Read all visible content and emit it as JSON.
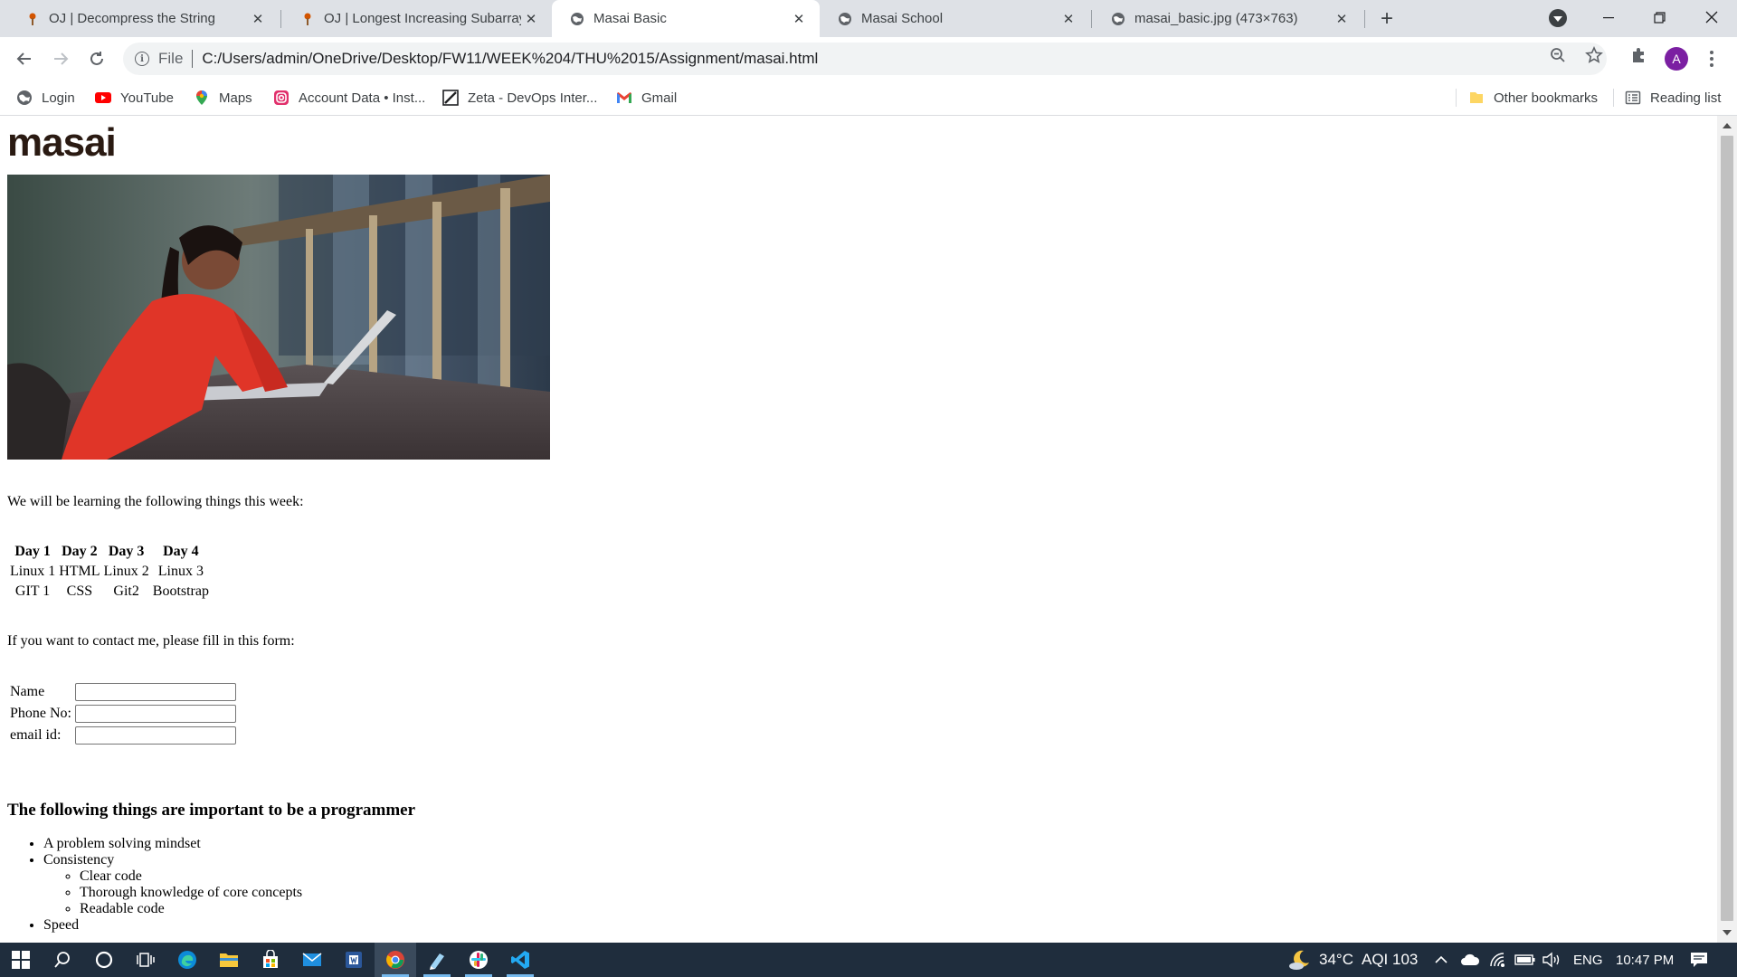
{
  "browser": {
    "tabs": [
      {
        "title": "OJ | Decompress the String",
        "favicon": "pin-favicon",
        "active": false
      },
      {
        "title": "OJ | Longest Increasing Subarray",
        "favicon": "pin-favicon",
        "active": false
      },
      {
        "title": "Masai Basic",
        "favicon": "globe-favicon",
        "active": true
      },
      {
        "title": "Masai School",
        "favicon": "globe-favicon",
        "active": false
      },
      {
        "title": "masai_basic.jpg (473×763)",
        "favicon": "globe-favicon",
        "active": false
      }
    ],
    "address": {
      "scheme_label": "File",
      "url": "C:/Users/admin/OneDrive/Desktop/FW11/WEEK%204/THU%2015/Assignment/masai.html"
    },
    "profile_initial": "A",
    "bookmarks": [
      {
        "label": "Login",
        "icon": "globe-icon"
      },
      {
        "label": "YouTube",
        "icon": "youtube-icon"
      },
      {
        "label": "Maps",
        "icon": "maps-pin-icon"
      },
      {
        "label": "Account Data • Inst...",
        "icon": "instagram-icon"
      },
      {
        "label": "Zeta - DevOps Inter...",
        "icon": "zeta-icon"
      },
      {
        "label": "Gmail",
        "icon": "gmail-icon"
      }
    ],
    "other_bookmarks": "Other bookmarks",
    "reading_list": "Reading list"
  },
  "page": {
    "logo": "masai",
    "intro": "We will be learning the following things this week:",
    "schedule": {
      "headers": [
        "Day 1",
        "Day 2",
        "Day 3",
        "Day 4"
      ],
      "rows": [
        [
          "Linux 1",
          "HTML",
          "Linux 2",
          "Linux 3"
        ],
        [
          "GIT 1",
          "CSS",
          "Git2",
          "Bootstrap"
        ]
      ]
    },
    "contact_text": "If you want to contact me, please fill in this form:",
    "form": {
      "name_label": "Name",
      "phone_label": "Phone No:",
      "email_label": "email id:"
    },
    "heading": "The following things are important to be a programmer",
    "list": {
      "item1": "A problem solving mindset",
      "item2": "Consistency",
      "sub1": "Clear code",
      "sub2": "Thorough knowledge of core concepts",
      "sub3": "Readable code",
      "item3": "Speed"
    }
  },
  "taskbar": {
    "weather": "34°C",
    "aqi": "AQI 103",
    "language": "ENG",
    "time": "10:47 PM"
  }
}
